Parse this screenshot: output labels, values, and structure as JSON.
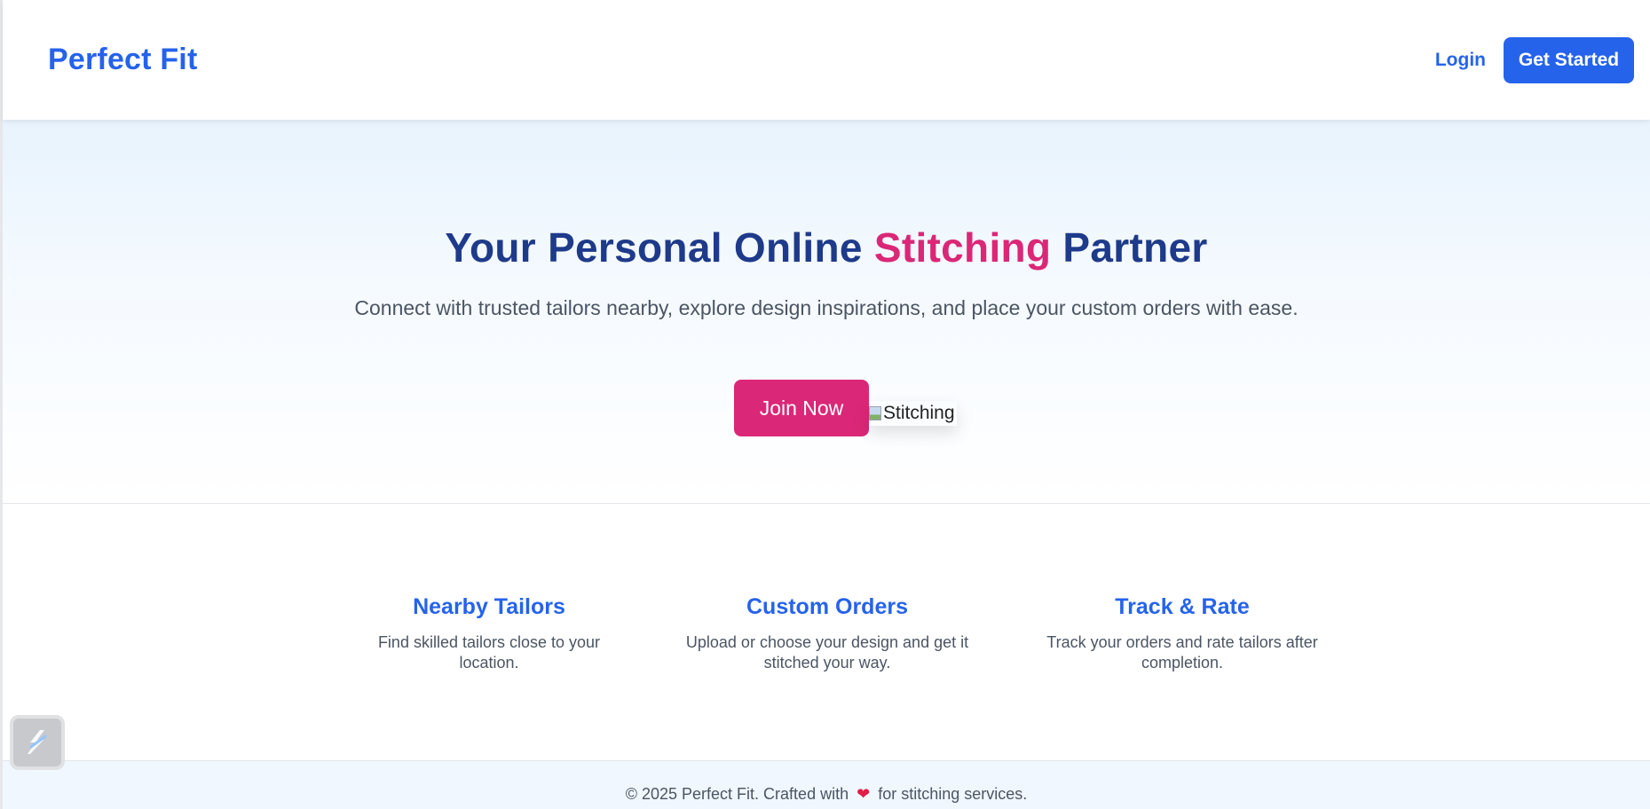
{
  "brand": {
    "name": "Perfect Fit",
    "color": "#2563eb"
  },
  "nav": {
    "login_label": "Login",
    "get_started_label": "Get Started"
  },
  "hero": {
    "title_before": "Your Personal Online ",
    "title_accent": "Stitching",
    "title_after": " Partner",
    "subtitle": "Connect with trusted tailors nearby, explore design inspirations, and place your custom orders with ease.",
    "join_label": "Join Now",
    "image_alt": "Stitching",
    "accent_color": "#db2777"
  },
  "features": [
    {
      "title": "Nearby Tailors",
      "description": "Find skilled tailors close to your location."
    },
    {
      "title": "Custom Orders",
      "description": "Upload or choose your design and get it stitched your way."
    },
    {
      "title": "Track & Rate",
      "description": "Track your orders and rate tailors after completion."
    }
  ],
  "footer": {
    "text_before": "© 2025 Perfect Fit. Crafted with",
    "heart": "❤",
    "text_after": "for stitching services."
  },
  "widget": {
    "icon": "app-logo-icon"
  }
}
